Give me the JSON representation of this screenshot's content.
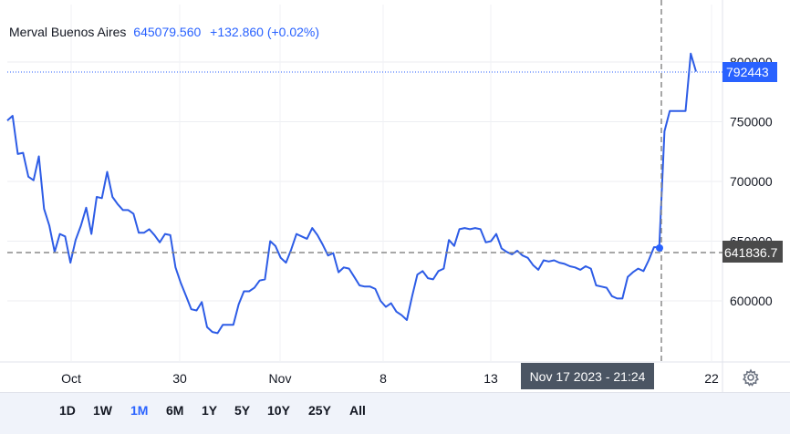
{
  "legend": {
    "name": "Merval Buenos Aires",
    "price": "645079.560",
    "change": "+132.860 (+0.02%)"
  },
  "colors": {
    "line": "#2d5ce6",
    "accent": "#2962ff",
    "crosshair": "#8a8a8a",
    "tooltip_bg": "#4b5563",
    "last_badge": "#2962ff",
    "cross_badge": "#4a4a4a"
  },
  "crosshair": {
    "date_label": "Nov 17 2023 - 21:24",
    "price_label": "641836.7"
  },
  "last_price_label": "792443",
  "range_buttons": [
    {
      "label": "1D",
      "active": false
    },
    {
      "label": "1W",
      "active": false
    },
    {
      "label": "1M",
      "active": true
    },
    {
      "label": "6M",
      "active": false
    },
    {
      "label": "1Y",
      "active": false
    },
    {
      "label": "5Y",
      "active": false
    },
    {
      "label": "10Y",
      "active": false
    },
    {
      "label": "25Y",
      "active": false
    },
    {
      "label": "All",
      "active": false
    }
  ],
  "settings_icon": "gear-icon",
  "chart_data": {
    "type": "line",
    "title": "",
    "xlabel": "",
    "ylabel": "",
    "x_tick_labels": [
      "Oct",
      "30",
      "Nov",
      "8",
      "13",
      "22"
    ],
    "y_tick_labels": [
      "600000",
      "650000",
      "700000",
      "750000",
      "800000"
    ],
    "y_ticks": [
      600000,
      650000,
      700000,
      750000,
      800000
    ],
    "ylim": [
      553000,
      823000
    ],
    "grid": true,
    "series": [
      {
        "values": [
          751000,
          755000,
          723000,
          724000,
          704000,
          701000,
          721000,
          677000,
          663000,
          641000,
          656000,
          654000,
          632000,
          651000,
          663000,
          678000,
          656000,
          687000,
          686000,
          708000,
          687000,
          681000,
          676000,
          676000,
          673000,
          657000,
          657000,
          660000,
          655000,
          649000,
          656000,
          655000,
          628000,
          615000,
          604000,
          593000,
          592000,
          599000,
          578000,
          574000,
          573000,
          580000,
          580000,
          580000,
          597000,
          608000,
          608000,
          611000,
          617000,
          618000,
          650000,
          646000,
          636000,
          632000,
          643000,
          656000,
          654000,
          652000,
          661000,
          655000,
          647000,
          638000,
          640000,
          624000,
          628000,
          627000,
          620000,
          613000,
          612000,
          612000,
          610000,
          600000,
          595000,
          598000,
          591000,
          588000,
          584000,
          604000,
          622000,
          625000,
          619000,
          618000,
          625000,
          627000,
          651000,
          646000,
          660000,
          661000,
          660000,
          661000,
          660000,
          649000,
          650000,
          656000,
          644000,
          641000,
          639000,
          642000,
          638000,
          636000,
          630000,
          626000,
          634000,
          633000,
          634000,
          632000,
          631000,
          629000,
          628000,
          626000,
          629000,
          627000,
          613000,
          612000,
          611000,
          604000,
          602000,
          602000,
          620000,
          624000,
          627000,
          625000,
          634000,
          645000,
          645000,
          742000,
          759000,
          759000,
          759000,
          759000,
          807000,
          792000
        ]
      }
    ]
  }
}
